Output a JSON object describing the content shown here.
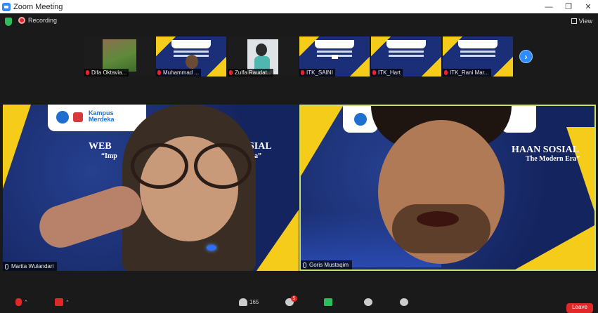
{
  "window": {
    "title": "Zoom Meeting"
  },
  "status": {
    "recording_label": "Recording",
    "view_label": "View"
  },
  "thumbnails": [
    {
      "name": "Difa Oktavia..."
    },
    {
      "name": "Muhammad ..."
    },
    {
      "name": "Zulfa Raudat..."
    },
    {
      "name": "ITK_SAINI"
    },
    {
      "name": "ITK_Hart"
    },
    {
      "name": "ITK_Rani Mar..."
    }
  ],
  "banner_text": {
    "left_title": "WEB",
    "left_title_right": "SIAL",
    "left_sub": "“Imp",
    "left_sub_right": "a”",
    "right_title": "HAAN SOSIAL",
    "right_sub": "The Modern Era”",
    "logo_kampus": "Kampus Merdeka"
  },
  "main_tiles": [
    {
      "name": "Marita Wulandari"
    },
    {
      "name": "Goris Mustaqim"
    }
  ],
  "toolbar": {
    "participants_count": "165",
    "chat_badge": "5",
    "leave_label": "Leave"
  },
  "colors": {
    "accent_blue": "#2d8cff",
    "active_speaker": "#c6e06a",
    "recording_red": "#e02828",
    "banner_yellow": "#f5cc1a",
    "banner_navy": "#1b2f78"
  }
}
